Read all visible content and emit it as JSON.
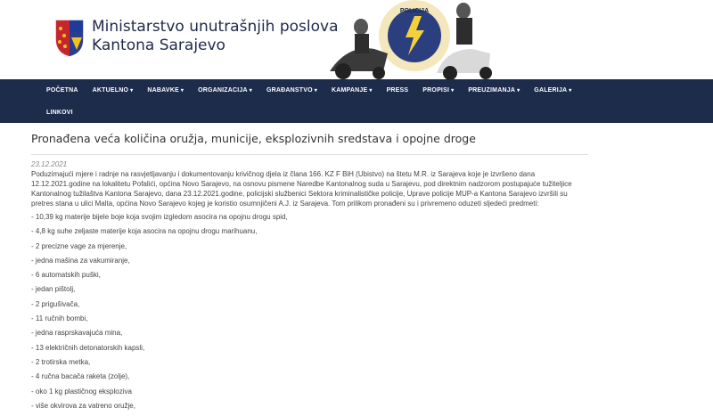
{
  "header": {
    "title_line1": "Ministarstvo unutrašnjih poslova",
    "title_line2": "Kantona Sarajevo"
  },
  "nav": {
    "items": [
      {
        "label": "POČETNA",
        "dropdown": false
      },
      {
        "label": "AKTUELNO",
        "dropdown": true
      },
      {
        "label": "NABAVKE",
        "dropdown": true
      },
      {
        "label": "ORGANIZACIJA",
        "dropdown": true
      },
      {
        "label": "GRAĐANSTVO",
        "dropdown": true
      },
      {
        "label": "KAMPANJE",
        "dropdown": true
      },
      {
        "label": "PRESS",
        "dropdown": false
      },
      {
        "label": "PROPISI",
        "dropdown": true
      },
      {
        "label": "PREUZIMANJA",
        "dropdown": true
      },
      {
        "label": "GALERIJA",
        "dropdown": true
      },
      {
        "label": "LINKOVI",
        "dropdown": false
      }
    ],
    "caret": "▾"
  },
  "article": {
    "title": "Pronađena veća količina oružja, municije, eksplozivnih sredstava i opojne droge",
    "date": "23.12.2021",
    "intro": "Poduzimajući mjere i radnje na rasvjetljavanju i dokumentovanju krivičnog djela iz člana 166. KZ F BiH (Ubistvo) na štetu M.R. iz Sarajeva koje je izvršeno dana 12.12.2021.godine na lokalitetu Pofalići, općina Novo Sarajevo, na osnovu pismene Naredbe Kantonalnog suda u Sarajevu, pod direktnim nadzorom postupajuće tužiteljice Kantonalnog tužilaštva Kantona Sarajevo, dana 23.12.2021.godine, policijski službenici Sektora kriminalističke policije, Uprave policije MUP-a Kantona Sarajevo izvršili su pretres stana u ulici Malta, općina Novo Sarajevo kojeg je koristio osumnjičeni A.J. iz Sarajeva. Tom prilikom pronađeni su i privremeno oduzeti sljedeći predmeti:",
    "items": [
      "- 10,39 kg materije bijele boje koja svojim izgledom asocira na opojnu drogu spid,",
      "- 4,8 kg suhe zeljaste materije koja asocira na opojnu drogu marihuanu,",
      "- 2 precizne vage za mjerenje,",
      "- jedna mašina za vakumiranje,",
      "- 6 automatskih puški,",
      "- jedan pištolj,",
      "- 2 prigušivača,",
      "- 11 ručnih bombi,",
      "- jedna rasprskavajuća mina,",
      "- 13 električnih detonatorskih kapsli,",
      "- 2 trotirska metka,",
      "- 4 ručna bacača raketa (zolje),",
      "- oko 1 kg plastičnog eksploziva",
      "- više okvirova za vatreno oružje,"
    ]
  },
  "colors": {
    "navbar": "#1d2c4b",
    "nav_text": "#ffffff",
    "title_text": "#1e2a4a",
    "body_text": "#444444",
    "date_text": "#888888"
  },
  "hero_badge_text": "POLICIJA"
}
